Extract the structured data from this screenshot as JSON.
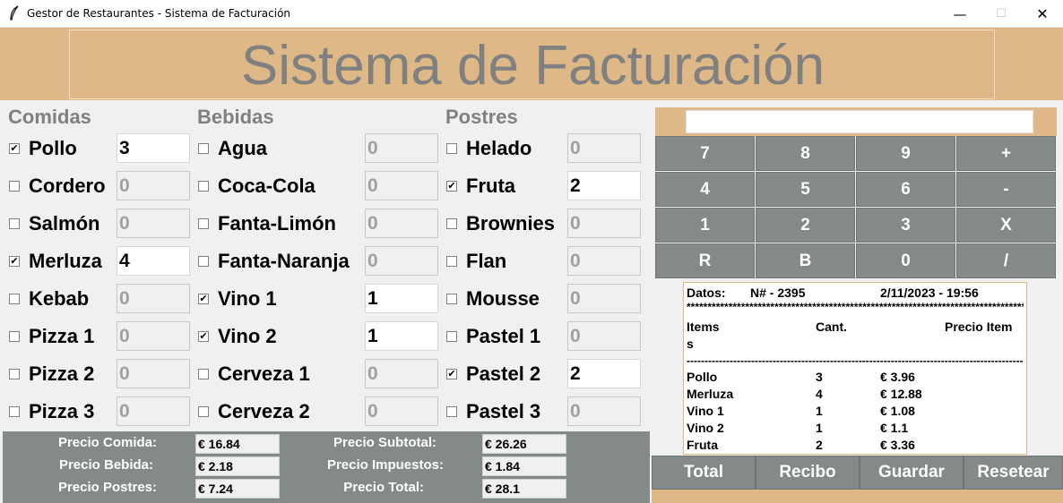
{
  "window": {
    "title": "Gestor de Restaurantes - Sistema de Facturación",
    "controls": {
      "minimize": "—",
      "maximize": "☐",
      "close": "✕"
    }
  },
  "header": {
    "title": "Sistema de Facturación"
  },
  "sections": {
    "comidas": {
      "title": "Comidas",
      "items": [
        {
          "label": "Pollo",
          "checked": true,
          "qty": "3"
        },
        {
          "label": "Cordero",
          "checked": false,
          "qty": "0"
        },
        {
          "label": "Salmón",
          "checked": false,
          "qty": "0"
        },
        {
          "label": "Merluza",
          "checked": true,
          "qty": "4"
        },
        {
          "label": "Kebab",
          "checked": false,
          "qty": "0"
        },
        {
          "label": "Pizza 1",
          "checked": false,
          "qty": "0"
        },
        {
          "label": "Pizza 2",
          "checked": false,
          "qty": "0"
        },
        {
          "label": "Pizza 3",
          "checked": false,
          "qty": "0"
        }
      ]
    },
    "bebidas": {
      "title": "Bebidas",
      "items": [
        {
          "label": "Agua",
          "checked": false,
          "qty": "0"
        },
        {
          "label": "Coca-Cola",
          "checked": false,
          "qty": "0"
        },
        {
          "label": "Fanta-Limón",
          "checked": false,
          "qty": "0"
        },
        {
          "label": "Fanta-Naranja",
          "checked": false,
          "qty": "0"
        },
        {
          "label": "Vino 1",
          "checked": true,
          "qty": "1"
        },
        {
          "label": "Vino 2",
          "checked": true,
          "qty": "1"
        },
        {
          "label": "Cerveza 1",
          "checked": false,
          "qty": "0"
        },
        {
          "label": "Cerveza 2",
          "checked": false,
          "qty": "0"
        }
      ]
    },
    "postres": {
      "title": "Postres",
      "items": [
        {
          "label": "Helado",
          "checked": false,
          "qty": "0"
        },
        {
          "label": "Fruta",
          "checked": true,
          "qty": "2"
        },
        {
          "label": "Brownies",
          "checked": false,
          "qty": "0"
        },
        {
          "label": "Flan",
          "checked": false,
          "qty": "0"
        },
        {
          "label": "Mousse",
          "checked": false,
          "qty": "0"
        },
        {
          "label": "Pastel 1",
          "checked": false,
          "qty": "0"
        },
        {
          "label": "Pastel 2",
          "checked": true,
          "qty": "2"
        },
        {
          "label": "Pastel 3",
          "checked": false,
          "qty": "0"
        }
      ]
    }
  },
  "costs": {
    "comida_label": "Precio Comida:",
    "comida_value": "€ 16.84",
    "bebida_label": "Precio Bebida:",
    "bebida_value": "€ 2.18",
    "postres_label": "Precio Postres:",
    "postres_value": "€ 7.24",
    "subtotal_label": "Precio Subtotal:",
    "subtotal_value": "€ 26.26",
    "impuestos_label": "Precio Impuestos:",
    "impuestos_value": "€ 1.84",
    "total_label": "Precio Total:",
    "total_value": "€ 28.1"
  },
  "calculator": {
    "display": "",
    "keys": [
      "7",
      "8",
      "9",
      "+",
      "4",
      "5",
      "6",
      "-",
      "1",
      "2",
      "3",
      "X",
      "R",
      "B",
      "0",
      "/"
    ]
  },
  "receipt": {
    "datos_label": "Datos:",
    "invoice": "N# - 2395",
    "datetime": "2/11/2023 - 19:56",
    "separator_star": "****************************************************************************************************",
    "col_items": "Items",
    "col_items_wrap": "s",
    "col_qty": "Cant.",
    "col_price": "Precio Item",
    "separator_dash": "----------------------------------------------------------------------------------------------------",
    "lines": [
      {
        "item": "Pollo",
        "qty": "3",
        "price": "€ 3.96"
      },
      {
        "item": "Merluza",
        "qty": "4",
        "price": "€ 12.88"
      },
      {
        "item": "Vino 1",
        "qty": "1",
        "price": "€ 1.08"
      },
      {
        "item": "Vino 2",
        "qty": "1",
        "price": "€ 1.1"
      },
      {
        "item": "Fruta",
        "qty": "2",
        "price": "€ 3.36"
      }
    ]
  },
  "buttons": {
    "total": "Total",
    "recibo": "Recibo",
    "guardar": "Guardar",
    "resetear": "Resetear"
  },
  "colors": {
    "tan": "#deb887",
    "panel_gray": "#838a89",
    "title_gray": "#808080"
  }
}
